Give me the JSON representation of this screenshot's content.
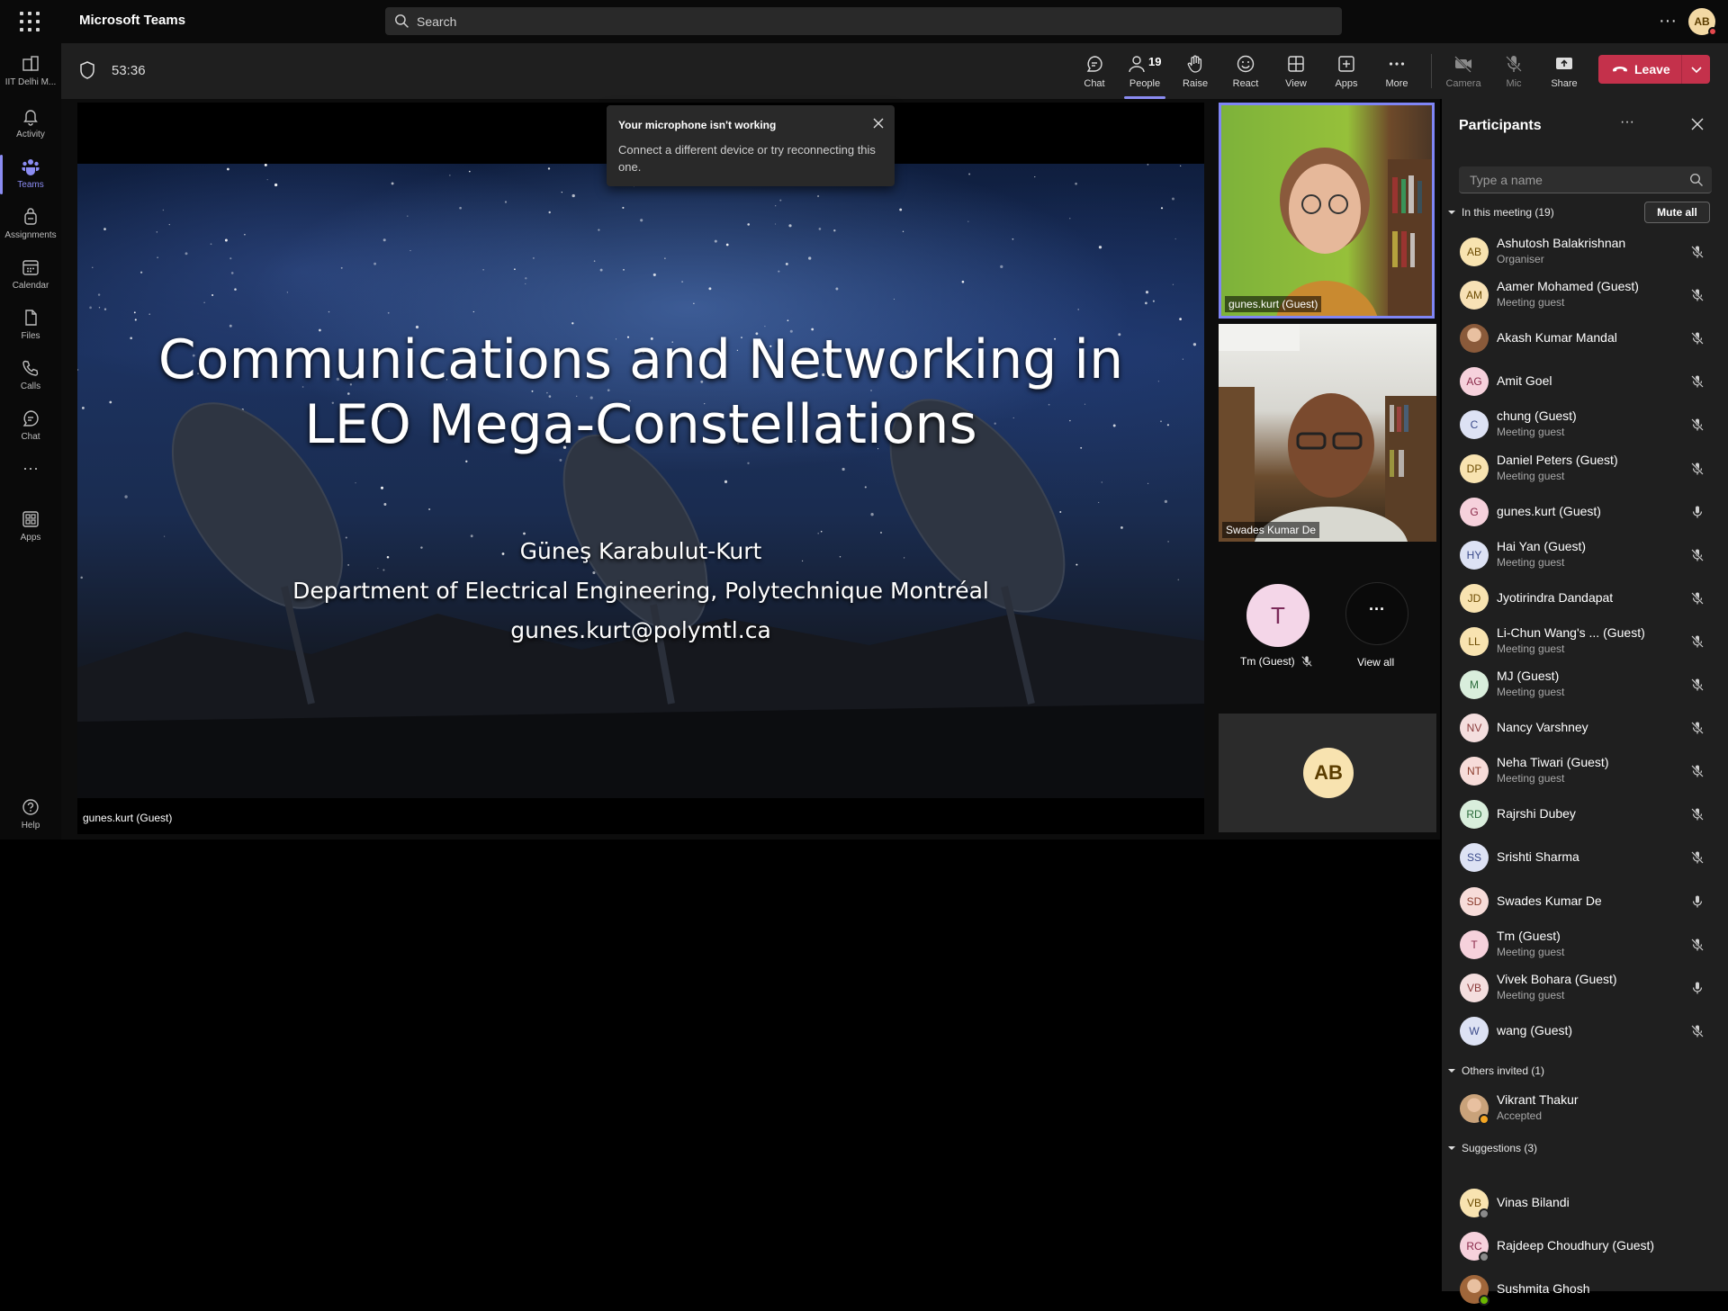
{
  "app": {
    "title": "Microsoft Teams",
    "search_placeholder": "Search",
    "more": "···",
    "avatar": "AB"
  },
  "rail": {
    "items": [
      {
        "label": "IIT Delhi M...",
        "icon": "org-icon"
      },
      {
        "label": "Activity",
        "icon": "bell-icon"
      },
      {
        "label": "Teams",
        "icon": "teams-icon",
        "active": true
      },
      {
        "label": "Assignments",
        "icon": "backpack-icon"
      },
      {
        "label": "Calendar",
        "icon": "calendar-icon"
      },
      {
        "label": "Files",
        "icon": "file-icon"
      },
      {
        "label": "Calls",
        "icon": "phone-icon"
      },
      {
        "label": "Chat",
        "icon": "chat-icon"
      },
      {
        "label": "···",
        "icon": "more-icon"
      },
      {
        "label": "Apps",
        "icon": "apps-icon"
      },
      {
        "label": "Help",
        "icon": "help-icon"
      }
    ]
  },
  "meeting": {
    "timer": "53:36",
    "toolbar": {
      "chat": "Chat",
      "people": "People",
      "people_count": "19",
      "raise": "Raise",
      "react": "React",
      "view": "View",
      "apps": "Apps",
      "more": "More",
      "camera": "Camera",
      "mic": "Mic",
      "share": "Share",
      "leave": "Leave"
    }
  },
  "slide": {
    "title_line1": "Communications and Networking in",
    "title_line2": "LEO Mega-Constellations",
    "author": "Güneş Karabulut-Kurt",
    "department": "Department of Electrical Engineering, Polytechnique Montréal",
    "email": "gunes.kurt@polymtl.ca",
    "caption": "gunes.kurt (Guest)"
  },
  "toast": {
    "title": "Your microphone isn't working",
    "body": "Connect a different device or try reconnecting this one."
  },
  "tiles": {
    "tile1_name": "gunes.kurt (Guest)",
    "tile2_name": "Swades Kumar De",
    "tm_initial": "T",
    "tm_name": "Tm (Guest)",
    "view_all_glyph": "···",
    "view_all": "View all",
    "self_initials": "AB"
  },
  "panel": {
    "title": "Participants",
    "more": "···",
    "search_placeholder": "Type a name",
    "in_meeting": "In this meeting (19)",
    "mute_all": "Mute all",
    "participants": [
      {
        "initials": "AB",
        "name": "Ashutosh Balakrishnan",
        "sub": "Organiser",
        "mic": "muted",
        "bg": "#f8e3b0",
        "fg": "#6b4a00"
      },
      {
        "initials": "AM",
        "name": "Aamer Mohamed (Guest)",
        "sub": "Meeting guest",
        "mic": "muted",
        "bg": "#f7e1b5",
        "fg": "#6b4a00"
      },
      {
        "initials": "",
        "name": "Akash Kumar Mandal",
        "sub": "",
        "mic": "muted",
        "bg": "#8a5a3a",
        "fg": "#fff",
        "photo": true
      },
      {
        "initials": "AG",
        "name": "Amit Goel",
        "sub": "",
        "mic": "muted",
        "bg": "#f6d1dc",
        "fg": "#8a2a4a"
      },
      {
        "initials": "C",
        "name": "chung (Guest)",
        "sub": "Meeting guest",
        "mic": "muted",
        "bg": "#dde2f4",
        "fg": "#3a4a8a"
      },
      {
        "initials": "DP",
        "name": "Daniel Peters (Guest)",
        "sub": "Meeting guest",
        "mic": "muted",
        "bg": "#f8e3b0",
        "fg": "#6b4a00"
      },
      {
        "initials": "G",
        "name": "gunes.kurt (Guest)",
        "sub": "",
        "mic": "on",
        "bg": "#f6d1dc",
        "fg": "#8a2a4a"
      },
      {
        "initials": "HY",
        "name": "Hai Yan (Guest)",
        "sub": "Meeting guest",
        "mic": "muted",
        "bg": "#dde2f4",
        "fg": "#3a4a8a"
      },
      {
        "initials": "JD",
        "name": "Jyotirindra Dandapat",
        "sub": "",
        "mic": "muted",
        "bg": "#f8e3b0",
        "fg": "#6b4a00"
      },
      {
        "initials": "LL",
        "name": "Li-Chun Wang's ... (Guest)",
        "sub": "Meeting guest",
        "mic": "muted",
        "bg": "#f8e3b0",
        "fg": "#6b4a00"
      },
      {
        "initials": "M",
        "name": "MJ (Guest)",
        "sub": "Meeting guest",
        "mic": "muted",
        "bg": "#d9eedc",
        "fg": "#2a6a3a"
      },
      {
        "initials": "NV",
        "name": "Nancy Varshney",
        "sub": "",
        "mic": "muted",
        "bg": "#f4dede",
        "fg": "#8a3a3a"
      },
      {
        "initials": "NT",
        "name": "Neha Tiwari (Guest)",
        "sub": "Meeting guest",
        "mic": "muted",
        "bg": "#f7dcd9",
        "fg": "#8a3a2a"
      },
      {
        "initials": "RD",
        "name": "Rajrshi Dubey",
        "sub": "",
        "mic": "muted",
        "bg": "#d9eedc",
        "fg": "#2a6a3a"
      },
      {
        "initials": "SS",
        "name": "Srishti Sharma",
        "sub": "",
        "mic": "muted",
        "bg": "#dde2f4",
        "fg": "#3a4a8a"
      },
      {
        "initials": "SD",
        "name": "Swades Kumar De",
        "sub": "",
        "mic": "on",
        "bg": "#f7dcd9",
        "fg": "#8a3a2a"
      },
      {
        "initials": "T",
        "name": "Tm (Guest)",
        "sub": "Meeting guest",
        "mic": "muted",
        "bg": "#f6d1dc",
        "fg": "#8a2a4a"
      },
      {
        "initials": "VB",
        "name": "Vivek Bohara (Guest)",
        "sub": "Meeting guest",
        "mic": "on",
        "bg": "#f4dede",
        "fg": "#8a3a3a"
      },
      {
        "initials": "W",
        "name": "wang (Guest)",
        "sub": "",
        "mic": "muted",
        "bg": "#dde2f4",
        "fg": "#3a4a8a"
      }
    ],
    "others_invited": "Others invited (1)",
    "invited": [
      {
        "initials": "",
        "name": "Vikrant Thakur",
        "sub": "Accepted",
        "bg": "#c9a27a",
        "fg": "#fff",
        "photo": true,
        "badge": "#f5a623"
      }
    ],
    "suggestions": "Suggestions (3)",
    "suggested": [
      {
        "initials": "VB",
        "name": "Vinas Bilandi",
        "sub": "",
        "bg": "#f8e3b0",
        "fg": "#6b4a00",
        "badge": "#8a8a8a"
      },
      {
        "initials": "RC",
        "name": "Rajdeep Choudhury (Guest)",
        "sub": "",
        "bg": "#f6d1dc",
        "fg": "#8a2a4a",
        "badge": "#8a8a8a"
      },
      {
        "initials": "",
        "name": "Sushmita Ghosh",
        "sub": "",
        "bg": "#a0663a",
        "fg": "#fff",
        "photo": true,
        "badge": "#6bb700"
      }
    ]
  }
}
